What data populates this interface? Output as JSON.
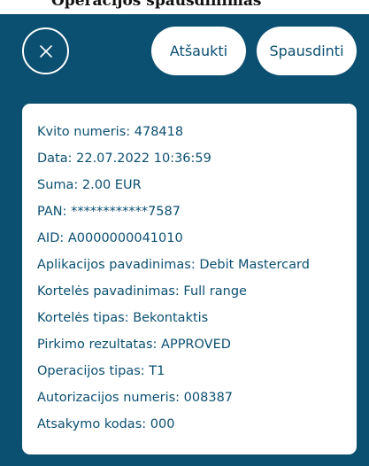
{
  "header_fragment": "Operacijos spausdinimas",
  "buttons": {
    "cancel_label": "Atšaukti",
    "print_label": "Spausdinti"
  },
  "receipt": {
    "lines": [
      "Kvito numeris: 478418",
      "Data: 22.07.2022 10:36:59",
      "Suma: 2.00 EUR",
      "PAN: ************7587",
      "AID: A0000000041010",
      "Aplikacijos pavadinimas: Debit Mastercard",
      "Kortelės pavadinimas: Full range",
      "Kortelės tipas: Bekontaktis",
      "Pirkimo rezultatas: APPROVED",
      "Operacijos tipas: T1",
      "Autorizacijos numeris: 008387",
      "Atsakymo kodas: 000"
    ]
  },
  "colors": {
    "background": "#0b4f71",
    "card": "#ffffff",
    "text": "#0b4f71"
  },
  "icons": {
    "close": "close-icon"
  }
}
